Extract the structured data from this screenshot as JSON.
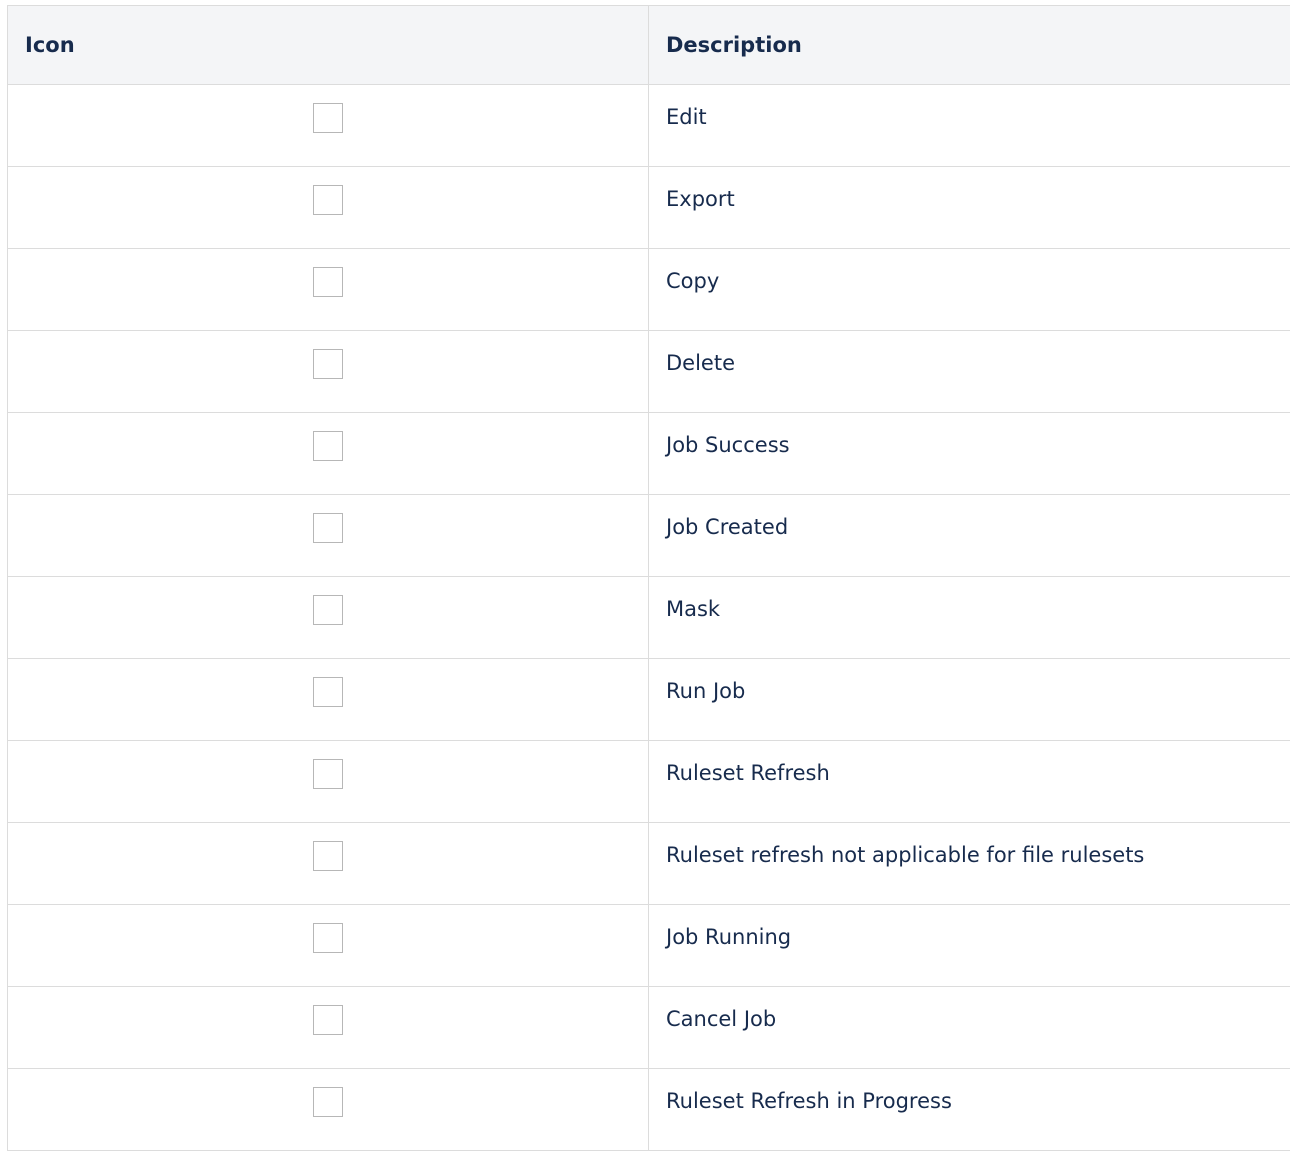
{
  "table": {
    "headers": {
      "icon": "Icon",
      "description": "Description"
    },
    "rows": [
      {
        "icon": "edit-icon",
        "description": "Edit"
      },
      {
        "icon": "export-icon",
        "description": "Export"
      },
      {
        "icon": "copy-icon",
        "description": "Copy"
      },
      {
        "icon": "delete-icon",
        "description": "Delete"
      },
      {
        "icon": "job-success-icon",
        "description": "Job Success"
      },
      {
        "icon": "job-created-icon",
        "description": "Job Created"
      },
      {
        "icon": "mask-icon",
        "description": "Mask"
      },
      {
        "icon": "run-job-icon",
        "description": "Run Job"
      },
      {
        "icon": "ruleset-refresh-icon",
        "description": "Ruleset Refresh"
      },
      {
        "icon": "ruleset-refresh-not-applicable-icon",
        "description": "Ruleset refresh not applicable for file rulesets"
      },
      {
        "icon": "job-running-icon",
        "description": "Job Running"
      },
      {
        "icon": "cancel-job-icon",
        "description": "Cancel Job"
      },
      {
        "icon": "ruleset-refresh-in-progress-icon",
        "description": "Ruleset Refresh in Progress"
      }
    ]
  }
}
